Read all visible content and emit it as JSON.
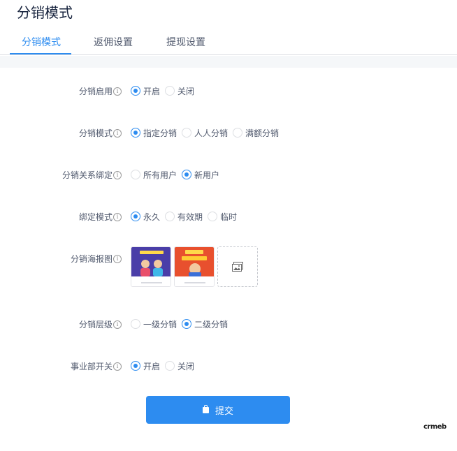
{
  "page": {
    "title": "分销模式"
  },
  "tabs": [
    {
      "label": "分销模式",
      "active": true
    },
    {
      "label": "返佣设置",
      "active": false
    },
    {
      "label": "提现设置",
      "active": false
    }
  ],
  "form": {
    "enable": {
      "label": "分销启用",
      "options": [
        "开启",
        "关闭"
      ],
      "selected": "开启"
    },
    "mode": {
      "label": "分销模式",
      "options": [
        "指定分销",
        "人人分销",
        "满额分销"
      ],
      "selected": "指定分销"
    },
    "binding": {
      "label": "分销关系绑定",
      "options": [
        "所有用户",
        "新用户"
      ],
      "selected": "新用户"
    },
    "bind_mode": {
      "label": "绑定模式",
      "options": [
        "永久",
        "有效期",
        "临时"
      ],
      "selected": "永久"
    },
    "poster": {
      "label": "分销海报图"
    },
    "level": {
      "label": "分销层级",
      "options": [
        "一级分销",
        "二级分销"
      ],
      "selected": "二级分销"
    },
    "division": {
      "label": "事业部开关",
      "options": [
        "开启",
        "关闭"
      ],
      "selected": "开启"
    }
  },
  "info_glyph": "i",
  "submit": {
    "label": "提交",
    "icon": "bag-icon"
  },
  "logo": {
    "text": "crmeb"
  },
  "colors": {
    "accent": "#2d8cf0",
    "band": "#f5f7f9"
  }
}
